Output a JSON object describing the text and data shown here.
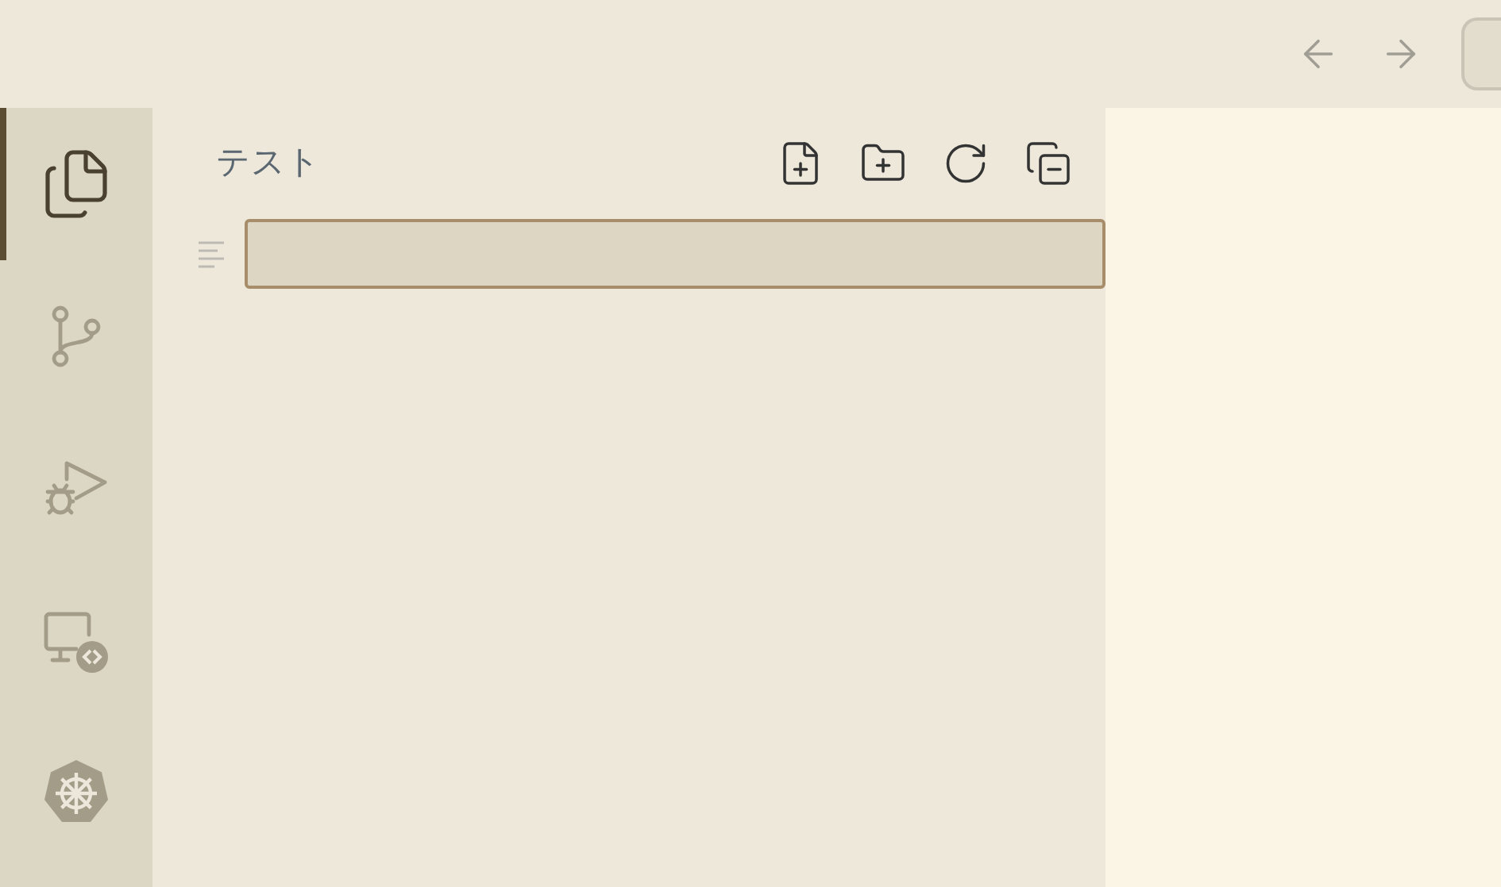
{
  "activity_bar": [
    {
      "kind": "files",
      "selected": true
    },
    {
      "kind": "branch",
      "selected": false
    },
    {
      "kind": "debug",
      "selected": false
    },
    {
      "kind": "remote",
      "selected": false
    },
    {
      "kind": "wheel",
      "selected": false
    }
  ],
  "sidebar": {
    "title": "テスト",
    "actions": [
      {
        "kind": "new-file"
      },
      {
        "kind": "new-folder"
      },
      {
        "kind": "refresh"
      },
      {
        "kind": "collapse"
      }
    ],
    "input": {
      "focused": true
    }
  }
}
